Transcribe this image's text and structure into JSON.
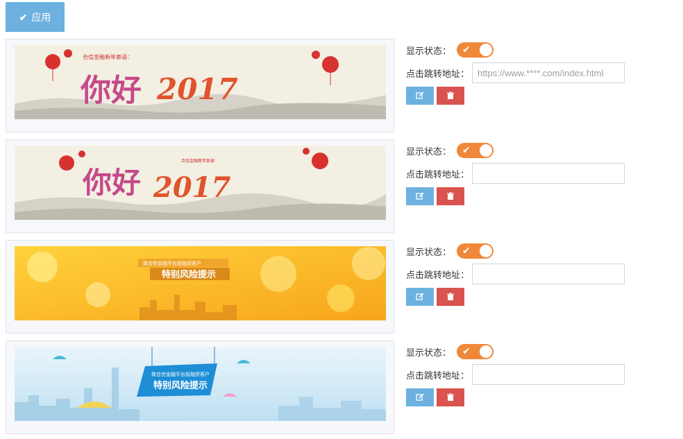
{
  "toolbar": {
    "apply_label": "应用"
  },
  "rows": [
    {
      "status_label": "显示状态：",
      "status_on": true,
      "url_label": "点击跳转地址：",
      "url_value": "",
      "url_placeholder": "https://www.****.com/index.html",
      "banner": {
        "text": [
          "你好",
          "2017"
        ],
        "small_text": "合信金融新年寄语："
      }
    },
    {
      "status_label": "显示状态：",
      "status_on": true,
      "url_label": "点击跳转地址：",
      "url_value": "",
      "url_placeholder": "",
      "banner": {
        "text": [
          "你好",
          "2017"
        ],
        "small_text": "合信金融新年致谢"
      }
    },
    {
      "status_label": "显示状态：",
      "status_on": true,
      "url_label": "点击跳转地址：",
      "url_value": "",
      "url_placeholder": "",
      "banner": {
        "text": [
          "特别风险提示"
        ],
        "small_text": "致合信金融平台投融资客户"
      }
    },
    {
      "status_label": "显示状态：",
      "status_on": true,
      "url_label": "点击跳转地址：",
      "url_value": "",
      "url_placeholder": "",
      "banner": {
        "text": [
          "特别风险提示"
        ],
        "small_text": "致合信金融平台投融资客户"
      }
    }
  ],
  "colors": {
    "primary": "#6cb1e0",
    "toggle_on": "#f0883a",
    "danger": "#d9534f"
  },
  "icons": {
    "apply": "check-icon",
    "toggle": "check-icon",
    "edit": "edit-icon",
    "delete": "trash-icon"
  }
}
